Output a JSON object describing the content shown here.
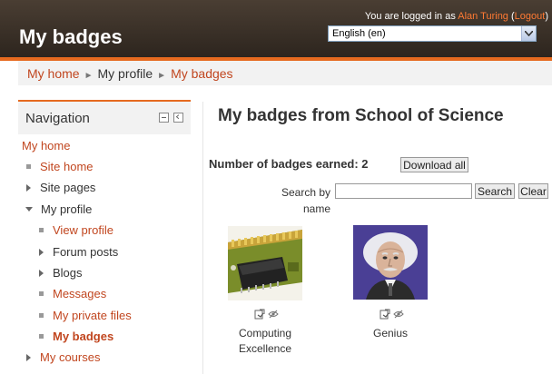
{
  "header": {
    "site_title": "My badges",
    "login_prefix": "You are logged in as ",
    "user_name": "Alan Turing",
    "logout_open": " (",
    "logout_label": "Logout",
    "logout_close": ")",
    "language": "English (en)"
  },
  "breadcrumb": {
    "items": [
      {
        "label": "My home"
      },
      {
        "label": "My profile"
      },
      {
        "label": "My badges"
      }
    ],
    "separator": "►"
  },
  "navigation": {
    "title": "Navigation",
    "items": [
      {
        "label": "My home"
      },
      {
        "label": "Site home"
      },
      {
        "label": "Site pages"
      },
      {
        "label": "My profile"
      },
      {
        "label": "View profile"
      },
      {
        "label": "Forum posts"
      },
      {
        "label": "Blogs"
      },
      {
        "label": "Messages"
      },
      {
        "label": "My private files"
      },
      {
        "label": "My badges"
      },
      {
        "label": "My courses"
      }
    ]
  },
  "main": {
    "title": "My badges from School of Science",
    "earned_label": "Number of badges earned: 2",
    "download_all": "Download all",
    "search_label_1": "Search by",
    "search_label_2": "name",
    "search_value": "",
    "search_button": "Search",
    "clear_button": "Clear",
    "badges": [
      {
        "name_line1": "Computing",
        "name_line2": "Excellence"
      },
      {
        "name_line1": "Genius",
        "name_line2": ""
      }
    ]
  },
  "colors": {
    "accent": "#e66a1f",
    "link": "#c1461f",
    "header_bg": "#3a3128"
  }
}
